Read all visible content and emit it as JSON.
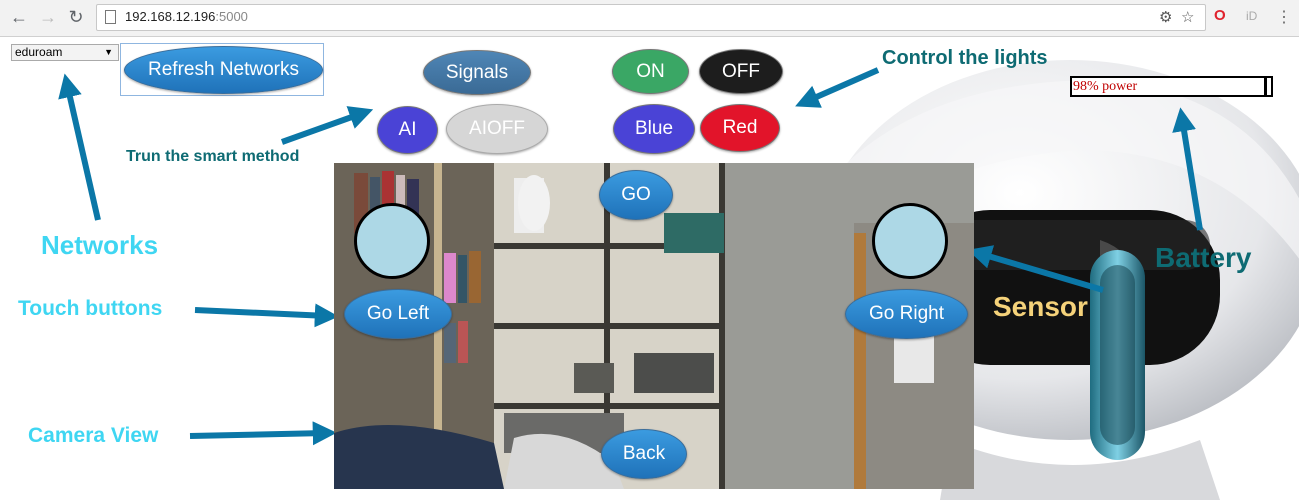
{
  "browser": {
    "url_host": "192.168.12.196",
    "url_port": ":5000"
  },
  "controls": {
    "network_select": "eduroam",
    "refresh_label": "Refresh Networks",
    "signals_label": "Signals",
    "ai_label": "AI",
    "aioff_label": "AIOFF",
    "on_label": "ON",
    "off_label": "OFF",
    "blue_label": "Blue",
    "red_label": "Red",
    "go_label": "GO",
    "go_left_label": "Go Left",
    "go_right_label": "Go Right",
    "back_label": "Back",
    "battery_text": "98% power",
    "battery_level": 0.98
  },
  "annotations": {
    "control_lights": "Control the lights",
    "smart_method": "Trun the smart method",
    "networks": "Networks",
    "battery": "Battery",
    "touch_buttons": "Touch buttons",
    "sensor": "Sensor",
    "camera_view": "Camera View"
  },
  "colors": {
    "annotation_teal": "#0e6b73",
    "annotation_cyan": "#3fd6f2",
    "arrow_blue": "#0b77a7",
    "sensor_fill": "#add8e6",
    "sensor_label": "#f5d27a"
  }
}
